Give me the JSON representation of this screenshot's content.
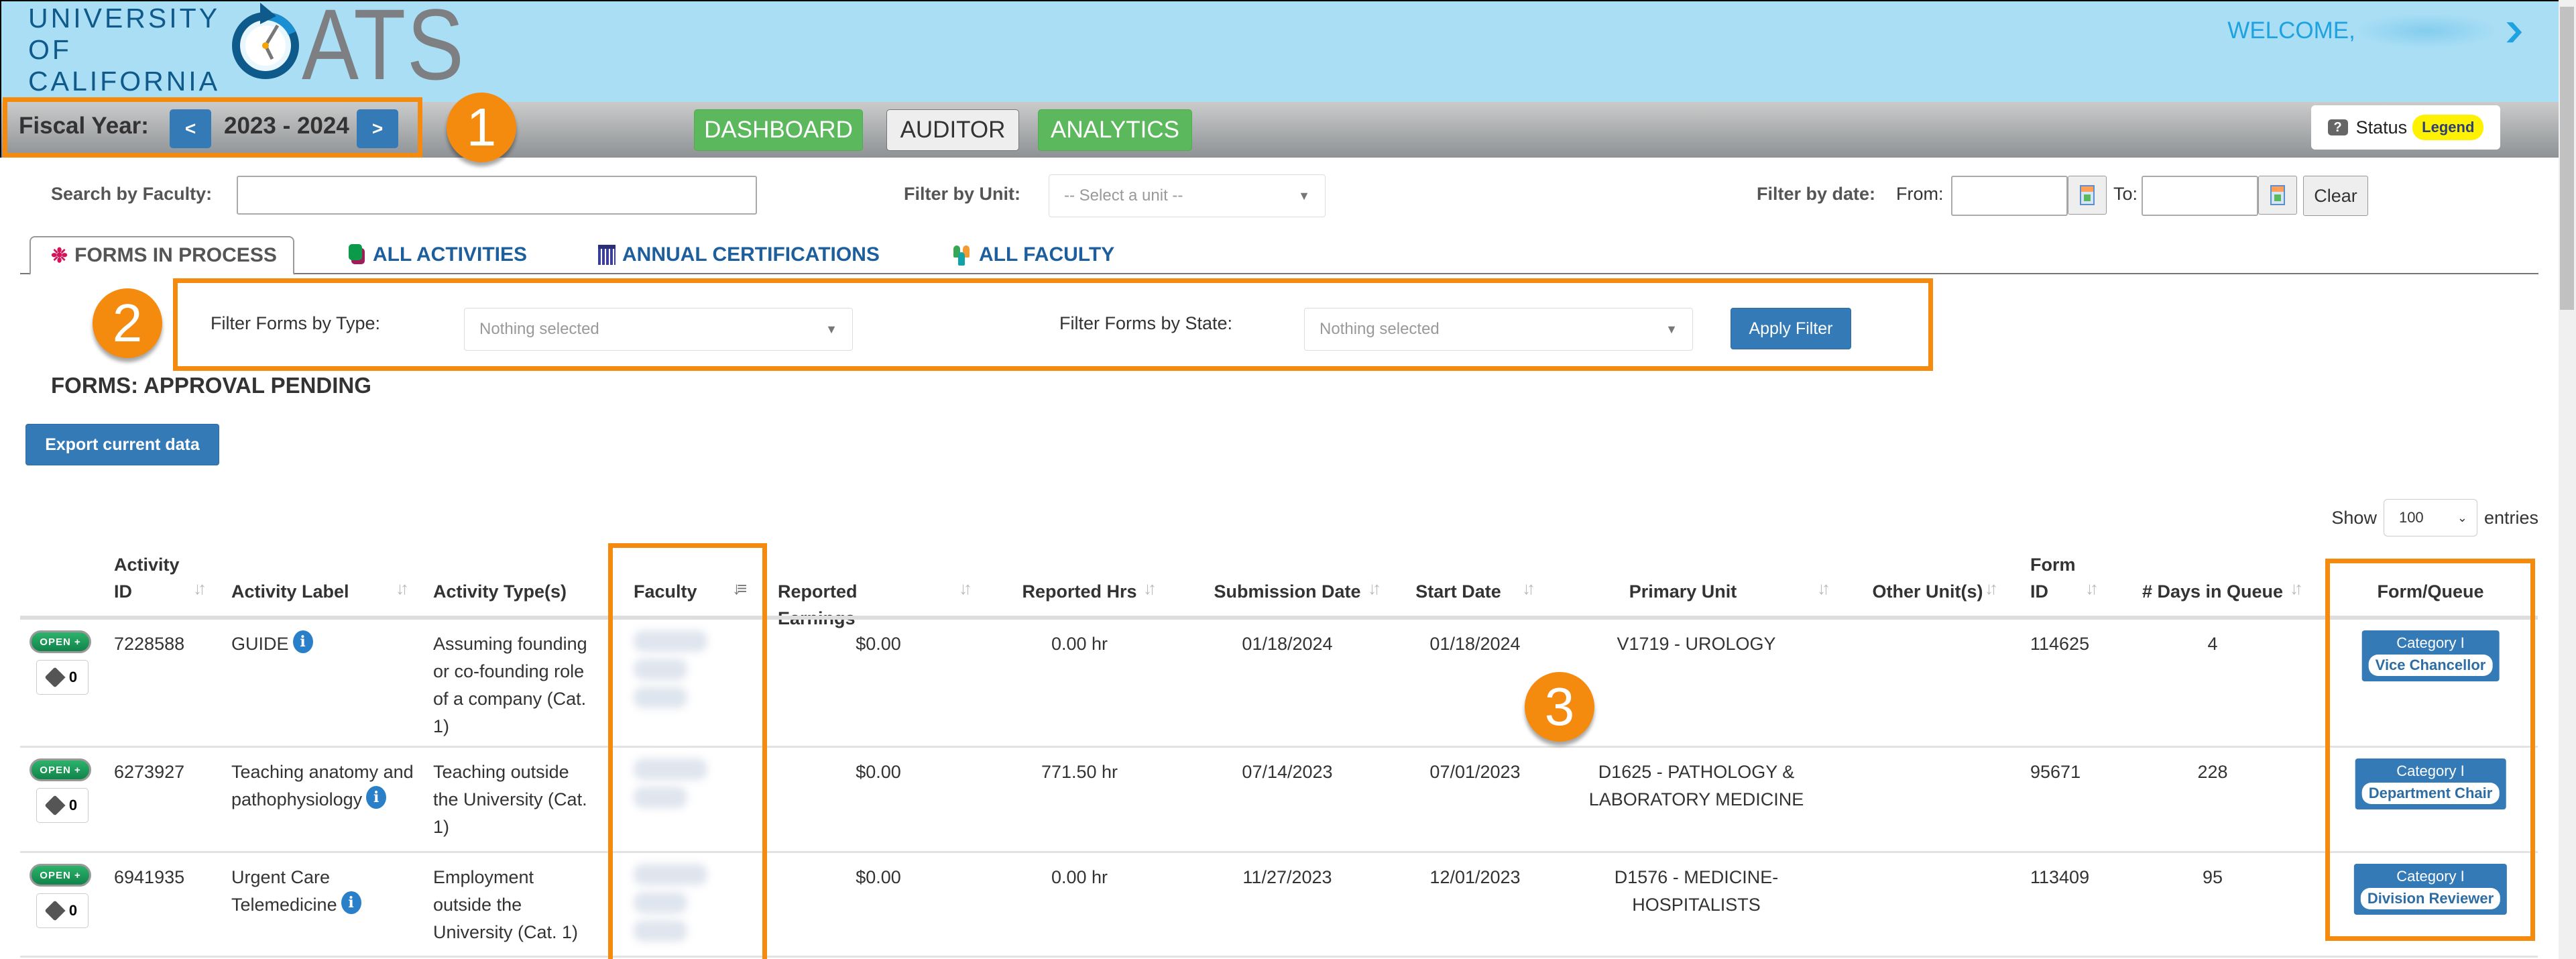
{
  "header": {
    "university_lines": [
      "UNIVERSITY",
      "OF",
      "CALIFORNIA"
    ],
    "app_name": "ATS",
    "welcome_label": "WELCOME,"
  },
  "navbar": {
    "fiscal_year_label": "Fiscal Year:",
    "prev_label": "<",
    "next_label": ">",
    "fiscal_year_value": "2023 - 2024",
    "buttons": [
      {
        "label": "DASHBOARD",
        "style": "green"
      },
      {
        "label": "AUDITOR",
        "style": "white"
      },
      {
        "label": "ANALYTICS",
        "style": "green"
      }
    ],
    "status_label": "Status",
    "legend_label": "Legend"
  },
  "callouts": [
    "1",
    "2",
    "3"
  ],
  "search": {
    "faculty_label": "Search by Faculty:",
    "faculty_value": "",
    "unit_label": "Filter by Unit:",
    "unit_placeholder": "-- Select a unit --",
    "date_label": "Filter by date:",
    "from_label": "From:",
    "to_label": "To:",
    "from_value": "",
    "to_value": "",
    "clear_label": "Clear"
  },
  "tabs": [
    {
      "label": "FORMS IN PROCESS",
      "icon": "gear-icon",
      "active": true
    },
    {
      "label": "ALL ACTIVITIES",
      "icon": "activities-icon",
      "active": false
    },
    {
      "label": "ANNUAL CERTIFICATIONS",
      "icon": "calendar-icon",
      "active": false
    },
    {
      "label": "ALL FACULTY",
      "icon": "people-icon",
      "active": false
    }
  ],
  "filters": {
    "type_label": "Filter Forms by Type:",
    "type_placeholder": "Nothing selected",
    "state_label": "Filter Forms by State:",
    "state_placeholder": "Nothing selected",
    "apply_label": "Apply Filter"
  },
  "section_title": "FORMS: APPROVAL PENDING",
  "export_label": "Export current data",
  "entries": {
    "show_label": "Show",
    "value": "100",
    "entries_label": "entries"
  },
  "table": {
    "columns": [
      {
        "line1": "Activity",
        "line2": "ID"
      },
      {
        "line1": "",
        "line2": "Activity Label"
      },
      {
        "line1": "",
        "line2": "Activity Type(s)"
      },
      {
        "line1": "",
        "line2": "Faculty"
      },
      {
        "line1": "",
        "line2": "Reported Earnings"
      },
      {
        "line1": "",
        "line2": "Reported Hrs"
      },
      {
        "line1": "",
        "line2": "Submission Date"
      },
      {
        "line1": "",
        "line2": "Start Date"
      },
      {
        "line1": "",
        "line2": "Primary Unit"
      },
      {
        "line1": "",
        "line2": "Other Unit(s)"
      },
      {
        "line1": "Form",
        "line2": "ID"
      },
      {
        "line1": "",
        "line2": "# Days in Queue"
      },
      {
        "line1": "",
        "line2": "Form/Queue"
      }
    ],
    "open_label": "OPEN +",
    "rows": [
      {
        "status": "OPEN",
        "tag_count": "0",
        "activity_id": "7228588",
        "activity_label": "GUIDE",
        "activity_type": "Assuming founding or co-founding role of a company (Cat. 1)",
        "faculty": "[redacted]",
        "earnings": "$0.00",
        "hours": "0.00 hr",
        "submission_date": "01/18/2024",
        "start_date": "01/18/2024",
        "primary_unit": "V1719 - UROLOGY",
        "other_units": "",
        "form_id": "114625",
        "days_in_queue": "4",
        "category": "Category I",
        "queue": "Vice Chancellor"
      },
      {
        "status": "OPEN",
        "tag_count": "0",
        "activity_id": "6273927",
        "activity_label": "Teaching anatomy and pathophysiology",
        "activity_type": "Teaching outside the University (Cat. 1)",
        "faculty": "[redacted]",
        "earnings": "$0.00",
        "hours": "771.50 hr",
        "submission_date": "07/14/2023",
        "start_date": "07/01/2023",
        "primary_unit": "D1625 - PATHOLOGY & LABORATORY MEDICINE",
        "other_units": "",
        "form_id": "95671",
        "days_in_queue": "228",
        "category": "Category I",
        "queue": "Department Chair"
      },
      {
        "status": "OPEN",
        "tag_count": "0",
        "activity_id": "6941935",
        "activity_label": "Urgent Care Telemedicine",
        "activity_type": "Employment outside the University (Cat. 1)",
        "faculty": "[redacted]",
        "earnings": "$0.00",
        "hours": "0.00 hr",
        "submission_date": "11/27/2023",
        "start_date": "12/01/2023",
        "primary_unit": "D1576 - MEDICINE-HOSPITALISTS",
        "other_units": "",
        "form_id": "113409",
        "days_in_queue": "95",
        "category": "Category I",
        "queue": "Division Reviewer"
      }
    ]
  },
  "colors": {
    "header_bg": "#a9def5",
    "accent_orange": "#f48b0f",
    "primary_blue": "#337ab7",
    "nav_green": "#5cb85c",
    "legend_yellow": "#fff200"
  }
}
